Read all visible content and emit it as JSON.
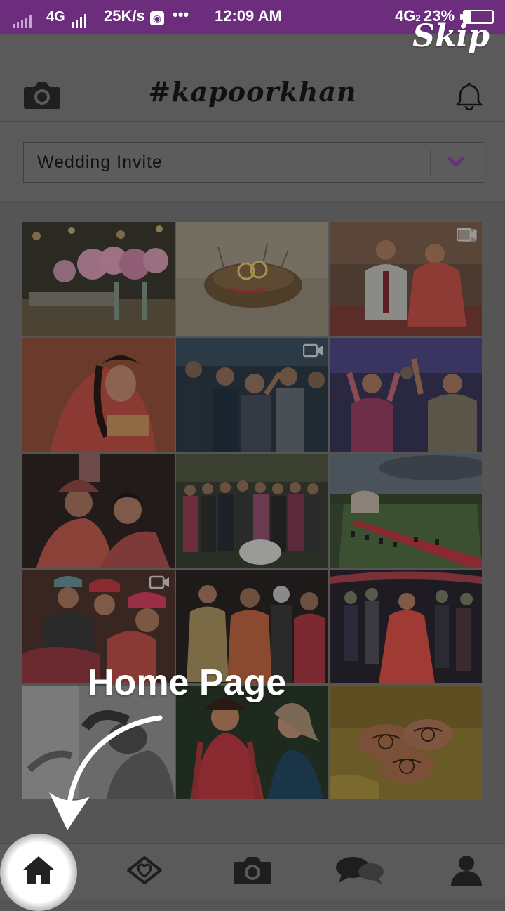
{
  "status_bar": {
    "network": "4G",
    "speed": "25K/s",
    "dots": "•••",
    "time": "12:09 AM",
    "network2": "4G",
    "network2_sub": "2",
    "battery": "23%",
    "battery_level": 0.23
  },
  "header": {
    "title": "#kapoorkhan",
    "left_icon": "camera-icon",
    "right_icon": "bell-icon"
  },
  "tutorial": {
    "skip_label": "Skip",
    "tip_text": "Home Page",
    "arrow_icon": "curved-arrow-icon"
  },
  "album_select": {
    "selected": "Wedding Invite",
    "icon": "chevron-down-icon"
  },
  "gallery": {
    "photos": [
      {
        "subject": "floral-table",
        "video": false
      },
      {
        "subject": "rings-nest",
        "video": false
      },
      {
        "subject": "couple-seated",
        "video": true
      },
      {
        "subject": "bride-portrait",
        "video": false
      },
      {
        "subject": "dancing-party",
        "video": true
      },
      {
        "subject": "dance-celebration",
        "video": false
      },
      {
        "subject": "bride-kiss",
        "video": false
      },
      {
        "subject": "group-photo",
        "video": false
      },
      {
        "subject": "outdoor-venue",
        "video": false
      },
      {
        "subject": "sikh-family",
        "video": true
      },
      {
        "subject": "ladies-sangeet",
        "video": false
      },
      {
        "subject": "bride-entry",
        "video": false
      },
      {
        "subject": "bw-bride",
        "video": false
      },
      {
        "subject": "laughing-bride",
        "video": false
      },
      {
        "subject": "mehendi-hands",
        "video": false
      }
    ]
  },
  "bottom_nav": {
    "items": [
      {
        "name": "home",
        "icon": "home-icon",
        "active": true
      },
      {
        "name": "couple",
        "icon": "hearts-diamond-icon",
        "active": false
      },
      {
        "name": "camera",
        "icon": "camera-icon",
        "active": false
      },
      {
        "name": "chat",
        "icon": "chat-bubbles-icon",
        "active": false
      },
      {
        "name": "profile",
        "icon": "user-icon",
        "active": false
      }
    ]
  },
  "colors": {
    "status_bar": "#6b2d7c",
    "accent": "#6b2d7c",
    "overlay_background": "#555555"
  }
}
